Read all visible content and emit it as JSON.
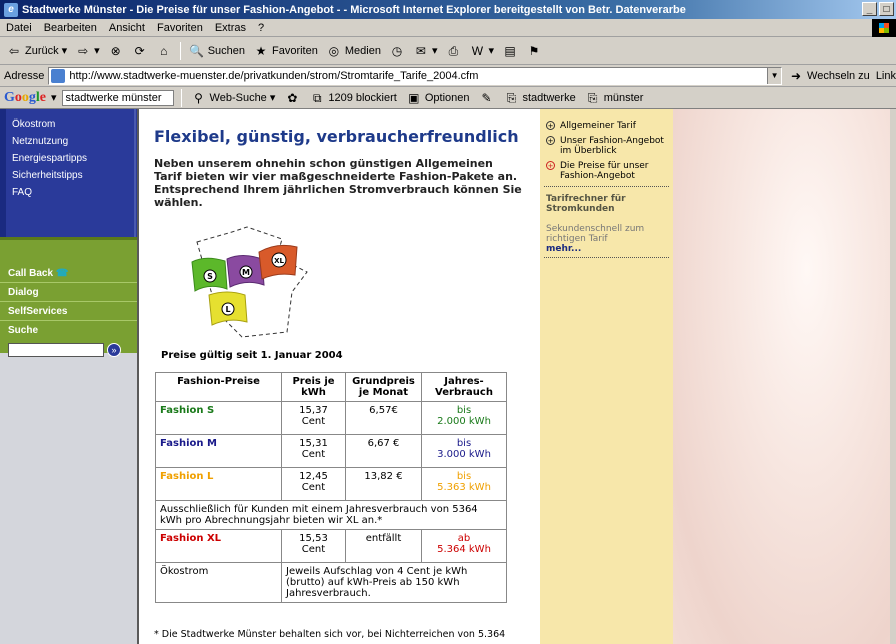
{
  "window": {
    "title": "Stadtwerke Münster - Die Preise für unser Fashion-Angebot - - Microsoft Internet Explorer bereitgestellt von Betr. Datenverarbe"
  },
  "menu": [
    "Datei",
    "Bearbeiten",
    "Ansicht",
    "Favoriten",
    "Extras",
    "?"
  ],
  "toolbar": {
    "back": "Zurück",
    "search": "Suchen",
    "favorites": "Favoriten",
    "media": "Medien"
  },
  "address": {
    "label": "Adresse",
    "url": "http://www.stadtwerke-muenster.de/privatkunden/strom/Stromtarife_Tarife_2004.cfm",
    "go": "Wechseln zu",
    "links": "Link"
  },
  "googlebar": {
    "logo": "Google",
    "query": "stadtwerke münster",
    "websearch": "Web-Suche",
    "blocked": "1209 blockiert",
    "options": "Optionen",
    "btn1": "stadtwerke",
    "btn2": "münster"
  },
  "nav": {
    "blue": [
      "Ökostrom",
      "Netznutzung",
      "Energiespartipps",
      "Sicherheitstipps",
      "FAQ"
    ],
    "green": [
      "Call Back",
      "Dialog",
      "SelfServices",
      "Suche"
    ]
  },
  "main": {
    "title": "Flexibel, günstig, verbraucherfreundlich",
    "intro": "Neben unserem ohnehin schon günstigen Allgemeinen Tarif bieten wir vier maßgeschneiderte Fashion-Pakete an. Entsprechend Ihrem jährlichen Stromverbrauch können Sie wählen.",
    "flags": [
      "S",
      "M",
      "XL",
      "L"
    ],
    "valid": "Preise gültig seit 1. Januar 2004",
    "table": {
      "h1": "Fashion-Preise",
      "h2": "Preis je kWh",
      "h3": "Grundpreis je Monat",
      "h4": "Jahres-Verbrauch",
      "s_name": "Fashion S",
      "s_price": "15,37 Cent",
      "s_base": "6,57€",
      "s_use1": "bis",
      "s_use2": "2.000 kWh",
      "m_name": "Fashion M",
      "m_price": "15,31 Cent",
      "m_base": "6,67 €",
      "m_use1": "bis",
      "m_use2": "3.000 kWh",
      "l_name": "Fashion L",
      "l_price": "12,45 Cent",
      "l_base": "13,82 €",
      "l_use1": "bis",
      "l_use2": "5.363 kWh",
      "xl_note": "Ausschließlich für Kunden mit einem Jahresverbrauch von 5364 kWh pro Abrechnungsjahr bieten wir XL an.*",
      "xl_name": "Fashion XL",
      "xl_price": "15,53 Cent",
      "xl_base": "entfällt",
      "xl_use1": "ab",
      "xl_use2": "5.364 kWh",
      "oeko_name": "Ökostrom",
      "oeko_text": "Jeweils Aufschlag von 4 Cent je kWh (brutto) auf kWh-Preis ab 150 kWh Jahresverbrauch."
    },
    "footnote": "* Die Stadtwerke Münster behalten sich vor, bei Nichterreichen von 5.364"
  },
  "right": {
    "links": [
      "Allgemeiner Tarif",
      "Unser Fashion-Angebot im Überblick",
      "Die Preise für unser Fashion-Angebot"
    ],
    "head": "Tarifrechner für Stromkunden",
    "text": "Sekundenschnell zum richtigen Tarif",
    "more": "mehr..."
  }
}
